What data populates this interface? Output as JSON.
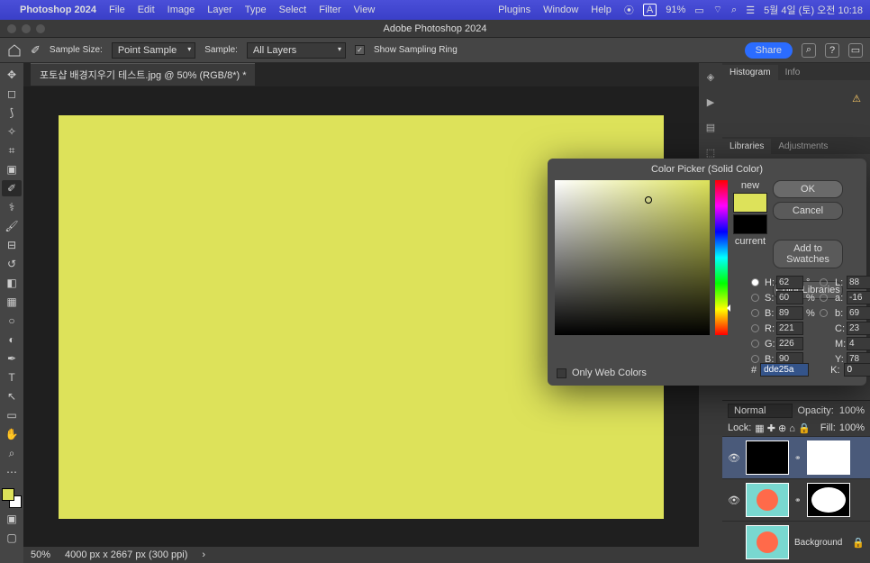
{
  "menubar": {
    "app": "Photoshop 2024",
    "items": [
      "File",
      "Edit",
      "Image",
      "Layer",
      "Type",
      "Select",
      "Filter",
      "View"
    ],
    "right_items": [
      "Plugins",
      "Window",
      "Help"
    ],
    "battery": "91%",
    "datetime": "5월 4일 (토) 오전 10:18"
  },
  "apptitle": "Adobe Photoshop 2024",
  "options": {
    "sample_size_label": "Sample Size:",
    "sample_size_value": "Point Sample",
    "sample_label": "Sample:",
    "sample_value": "All Layers",
    "show_ring": "Show Sampling Ring",
    "share": "Share"
  },
  "doc": {
    "tab": "포토샵 배경지우기 테스트.jpg @ 50% (RGB/8*) *",
    "zoom": "50%",
    "dims": "4000 px x 2667 px (300 ppi)"
  },
  "panels": {
    "histogram": "Histogram",
    "info": "Info",
    "libraries": "Libraries",
    "adjustments": "Adjustments"
  },
  "layers": {
    "blend": "Normal",
    "opacity_label": "Opacity:",
    "opacity_value": "100%",
    "lock_label": "Lock:",
    "fill_label": "Fill:",
    "fill_value": "100%",
    "background": "Background"
  },
  "dialog": {
    "title": "Color Picker (Solid Color)",
    "ok": "OK",
    "cancel": "Cancel",
    "add_swatches": "Add to Swatches",
    "color_libs": "Color Libraries",
    "new": "new",
    "current": "current",
    "owc": "Only Web Colors",
    "H": "62",
    "S": "60",
    "Bv": "89",
    "R": "221",
    "G": "226",
    "Bb": "90",
    "L": "88",
    "a": "-16",
    "b2": "69",
    "C": "23",
    "M": "4",
    "Y": "78",
    "K": "0",
    "hex": "dde25a",
    "deg": "°",
    "pct": "%",
    "hash": "#",
    "lbl_H": "H:",
    "lbl_S": "S:",
    "lbl_B": "B:",
    "lbl_R": "R:",
    "lbl_G": "G:",
    "lbl_Bb": "B:",
    "lbl_L": "L:",
    "lbl_a": "a:",
    "lbl_b": "b:",
    "lbl_C": "C:",
    "lbl_M": "M:",
    "lbl_Y": "Y:",
    "lbl_K": "K:"
  }
}
